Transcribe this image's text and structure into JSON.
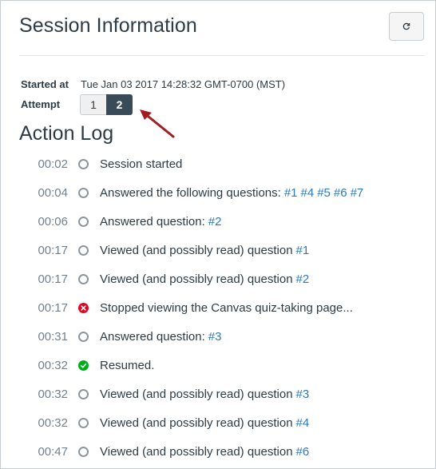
{
  "header": {
    "title": "Session Information",
    "refresh_icon": "refresh-icon"
  },
  "session": {
    "started_label": "Started at",
    "started_value": "Tue Jan 03 2017 14:28:32 GMT-0700 (MST)",
    "attempt_label": "Attempt",
    "attempts": [
      "1",
      "2"
    ],
    "selected_attempt": "2"
  },
  "action_log": {
    "title": "Action Log",
    "entries": [
      {
        "time": "00:02",
        "status": "neutral",
        "text": "Session started",
        "links": []
      },
      {
        "time": "00:04",
        "status": "neutral",
        "text": "Answered the following questions:",
        "links": [
          "#1",
          "#4",
          "#5",
          "#6",
          "#7"
        ]
      },
      {
        "time": "00:06",
        "status": "neutral",
        "text": "Answered question:",
        "links": [
          "#2"
        ]
      },
      {
        "time": "00:17",
        "status": "neutral",
        "text": "Viewed (and possibly read) question",
        "links": [
          "#1"
        ]
      },
      {
        "time": "00:17",
        "status": "neutral",
        "text": "Viewed (and possibly read) question",
        "links": [
          "#2"
        ]
      },
      {
        "time": "00:17",
        "status": "error",
        "text": "Stopped viewing the Canvas quiz-taking page...",
        "links": []
      },
      {
        "time": "00:31",
        "status": "neutral",
        "text": "Answered question:",
        "links": [
          "#3"
        ]
      },
      {
        "time": "00:32",
        "status": "success",
        "text": "Resumed.",
        "links": []
      },
      {
        "time": "00:32",
        "status": "neutral",
        "text": "Viewed (and possibly read) question",
        "links": [
          "#3"
        ]
      },
      {
        "time": "00:32",
        "status": "neutral",
        "text": "Viewed (and possibly read) question",
        "links": [
          "#4"
        ]
      },
      {
        "time": "00:47",
        "status": "neutral",
        "text": "Viewed (and possibly read) question",
        "links": [
          "#6"
        ]
      }
    ]
  },
  "colors": {
    "link": "#2b7abc",
    "active_attempt": "#394b58",
    "error": "#e0061f",
    "success": "#00ac18",
    "annotation_arrow": "#a31c22"
  }
}
